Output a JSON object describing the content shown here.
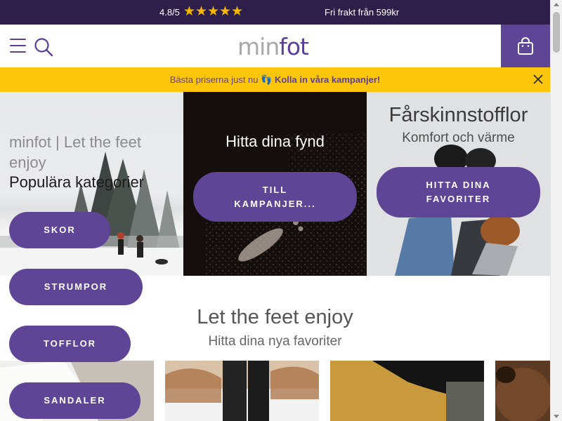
{
  "topbar": {
    "rating": "4.8/5",
    "stars": "★★★★★",
    "shipping": "Fri frakt från 599kr"
  },
  "header": {
    "logo_part1": "min",
    "logo_part2": "fot",
    "menu_icon": "hamburger-menu-icon",
    "search_icon": "search-icon",
    "cart_icon": "shopping-bag-icon"
  },
  "promo": {
    "text": "Bästa priserna just nu",
    "emoji": "👣",
    "link": "Kolla in våra kampanjer!"
  },
  "hero": {
    "tile1": {
      "title": "minfot | Let the feet enjoy",
      "subtitle": "Populära kategorier"
    },
    "tile2": {
      "title": "Hitta dina fynd",
      "button_line1": "TILL",
      "button_line2": "KAMPANJER..."
    },
    "tile3": {
      "title": "Fårskinnstofflor",
      "subtitle": "Komfort och värme",
      "button_line1": "HITTA DINA",
      "button_line2": "FAVORITER"
    }
  },
  "categories": [
    {
      "label": "SKOR"
    },
    {
      "label": "STRUMPOR"
    },
    {
      "label": "TOFFLOR"
    },
    {
      "label": "SANDALER"
    }
  ],
  "section": {
    "title": "Let the feet enjoy",
    "subtitle": "Hitta dina nya favoriter"
  },
  "colors": {
    "brand_purple": "#5e4596",
    "topbar_bg": "#2e1f4a",
    "promo_yellow": "#fdc60a",
    "star_gold": "#f5b800"
  }
}
